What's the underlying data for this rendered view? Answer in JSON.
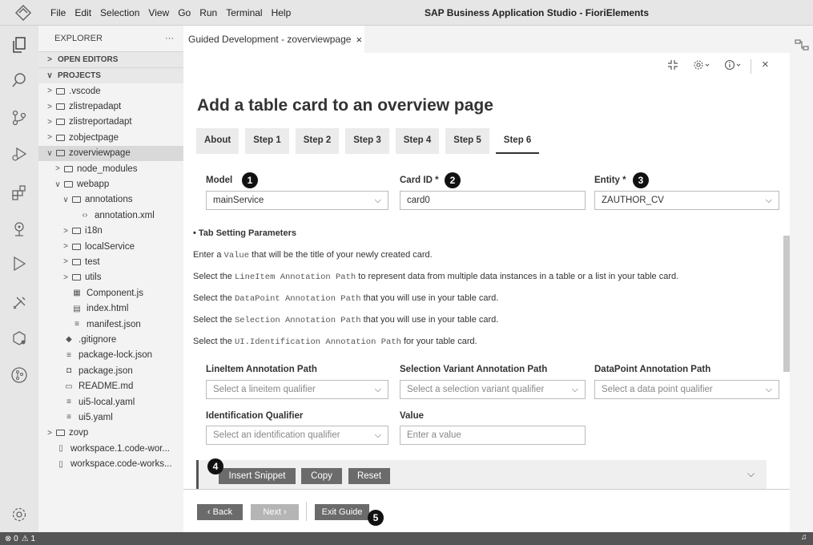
{
  "menu": [
    "File",
    "Edit",
    "Selection",
    "View",
    "Go",
    "Run",
    "Terminal",
    "Help"
  ],
  "window_title": "SAP Business Application Studio - FioriElements",
  "activity_icons": [
    "explorer-icon",
    "search-icon",
    "source-control-icon",
    "debug-icon",
    "extensions-icon",
    "map-pin-icon",
    "run-icon",
    "tools-icon",
    "storage-icon",
    "git-graph-icon",
    "settings-gear-icon"
  ],
  "sidebar": {
    "title": "EXPLORER",
    "more": "···",
    "open_editors": "OPEN EDITORS",
    "projects": "PROJECTS",
    "tree": [
      {
        "label": ".vscode",
        "indent": 0,
        "tw": ">",
        "type": "folder"
      },
      {
        "label": "zlistrepadapt",
        "indent": 0,
        "tw": ">",
        "type": "folder"
      },
      {
        "label": "zlistreportadapt",
        "indent": 0,
        "tw": ">",
        "type": "folder"
      },
      {
        "label": "zobjectpage",
        "indent": 0,
        "tw": ">",
        "type": "folder"
      },
      {
        "label": "zoverviewpage",
        "indent": 0,
        "tw": "∨",
        "type": "folder",
        "selected": true
      },
      {
        "label": "node_modules",
        "indent": 1,
        "tw": ">",
        "type": "folder"
      },
      {
        "label": "webapp",
        "indent": 1,
        "tw": "∨",
        "type": "folder"
      },
      {
        "label": "annotations",
        "indent": 2,
        "tw": "∨",
        "type": "folder"
      },
      {
        "label": "annotation.xml",
        "indent": 3,
        "tw": "",
        "type": "file",
        "icon": "‹›"
      },
      {
        "label": "i18n",
        "indent": 2,
        "tw": ">",
        "type": "folder"
      },
      {
        "label": "localService",
        "indent": 2,
        "tw": ">",
        "type": "folder"
      },
      {
        "label": "test",
        "indent": 2,
        "tw": ">",
        "type": "folder"
      },
      {
        "label": "utils",
        "indent": 2,
        "tw": ">",
        "type": "folder"
      },
      {
        "label": "Component.js",
        "indent": 2,
        "tw": "",
        "type": "file",
        "icon": "▦"
      },
      {
        "label": "index.html",
        "indent": 2,
        "tw": "",
        "type": "file",
        "icon": "▤"
      },
      {
        "label": "manifest.json",
        "indent": 2,
        "tw": "",
        "type": "file",
        "icon": "≡"
      },
      {
        "label": ".gitignore",
        "indent": 1,
        "tw": "",
        "type": "file",
        "icon": "◆"
      },
      {
        "label": "package-lock.json",
        "indent": 1,
        "tw": "",
        "type": "file",
        "icon": "≡"
      },
      {
        "label": "package.json",
        "indent": 1,
        "tw": "",
        "type": "file",
        "icon": "◘"
      },
      {
        "label": "README.md",
        "indent": 1,
        "tw": "",
        "type": "file",
        "icon": "▭"
      },
      {
        "label": "ui5-local.yaml",
        "indent": 1,
        "tw": "",
        "type": "file",
        "icon": "≡"
      },
      {
        "label": "ui5.yaml",
        "indent": 1,
        "tw": "",
        "type": "file",
        "icon": "≡"
      },
      {
        "label": "zovp",
        "indent": 0,
        "tw": ">",
        "type": "folder"
      },
      {
        "label": "workspace.1.code-wor...",
        "indent": 0,
        "tw": "",
        "type": "file",
        "icon": "▯"
      },
      {
        "label": "workspace.code-works...",
        "indent": 0,
        "tw": "",
        "type": "file",
        "icon": "▯"
      }
    ]
  },
  "editor": {
    "tab_label": "Guided Development - zoverviewpage",
    "tab_close": "×",
    "page_title": "Add a table card to an overview page",
    "steps": [
      "About",
      "Step 1",
      "Step 2",
      "Step 3",
      "Step 4",
      "Step 5",
      "Step 6"
    ],
    "active_step": 6,
    "model_label": "Model",
    "model_value": "mainService",
    "cardid_label": "Card ID *",
    "cardid_value": "card0",
    "entity_label": "Entity *",
    "entity_value": "ZAUTHOR_CV",
    "tab_params_heading": "• Tab Setting Parameters",
    "lines": [
      {
        "pre": "Enter a ",
        "code": "Value",
        "post": " that will be the title of your newly created card."
      },
      {
        "pre": "Select the ",
        "code": "LineItem Annotation Path",
        "post": " to represent data from multiple data instances in a table or a list in your table card."
      },
      {
        "pre": "Select the ",
        "code": "DataPoint Annotation Path",
        "post": " that you will use in your table card."
      },
      {
        "pre": "Select the ",
        "code": "Selection Annotation Path",
        "post": " that you will use in your table card."
      },
      {
        "pre": "Select the ",
        "code": "UI.Identification Annotation Path",
        "post": " for your table card."
      }
    ],
    "lineitem_label": "LineItem Annotation Path",
    "lineitem_placeholder": "Select a lineitem qualifier",
    "selection_label": "Selection Variant Annotation Path",
    "selection_placeholder": "Select a selection variant qualifier",
    "datapoint_label": "DataPoint Annotation Path",
    "datapoint_placeholder": "Select a data point qualifier",
    "identification_label": "Identification Qualifier",
    "identification_placeholder": "Select an identification qualifier",
    "value_label": "Value",
    "value_placeholder": "Enter a value",
    "insert_snippet": "Insert Snippet",
    "copy": "Copy",
    "reset": "Reset",
    "back": "‹ Back",
    "next": "Next ›",
    "exit_guide": "Exit Guide",
    "callouts": [
      "1",
      "2",
      "3",
      "4",
      "5"
    ]
  },
  "statusbar": {
    "errors": "⊗ 0",
    "warnings": "⚠ 1"
  }
}
